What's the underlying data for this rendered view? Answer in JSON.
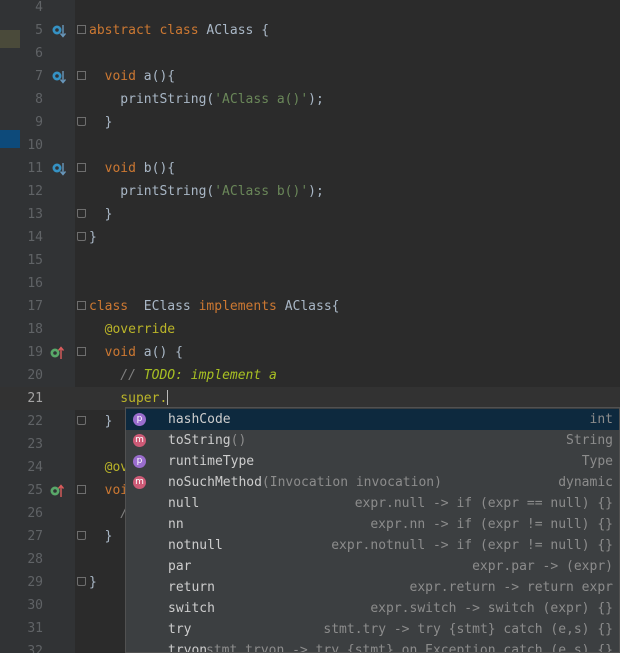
{
  "editor": {
    "rows": [
      {
        "n": "4",
        "tokens": []
      },
      {
        "n": "5",
        "tokens": [
          {
            "t": "abstract class ",
            "c": "kw"
          },
          {
            "t": "AClass {",
            "c": "cls"
          }
        ],
        "icon": "override",
        "fold": "start"
      },
      {
        "n": "6",
        "tokens": []
      },
      {
        "n": "7",
        "tokens": [
          {
            "t": "  void ",
            "c": "kw"
          },
          {
            "t": "a(){",
            "c": "cls"
          }
        ],
        "icon": "override",
        "fold": "start"
      },
      {
        "n": "8",
        "tokens": [
          {
            "t": "    printString(",
            "c": "cls"
          },
          {
            "t": "'AClass a()'",
            "c": "str"
          },
          {
            "t": ");",
            "c": "cls"
          }
        ]
      },
      {
        "n": "9",
        "tokens": [
          {
            "t": "  }",
            "c": "cls"
          }
        ],
        "fold": "end"
      },
      {
        "n": "10",
        "tokens": []
      },
      {
        "n": "11",
        "tokens": [
          {
            "t": "  void ",
            "c": "kw"
          },
          {
            "t": "b(){",
            "c": "cls"
          }
        ],
        "icon": "override",
        "fold": "start"
      },
      {
        "n": "12",
        "tokens": [
          {
            "t": "    printString(",
            "c": "cls"
          },
          {
            "t": "'AClass b()'",
            "c": "str"
          },
          {
            "t": ");",
            "c": "cls"
          }
        ]
      },
      {
        "n": "13",
        "tokens": [
          {
            "t": "  }",
            "c": "cls"
          }
        ],
        "fold": "end"
      },
      {
        "n": "14",
        "tokens": [
          {
            "t": "}",
            "c": "cls"
          }
        ],
        "fold": "end"
      },
      {
        "n": "15",
        "tokens": []
      },
      {
        "n": "16",
        "tokens": []
      },
      {
        "n": "17",
        "tokens": [
          {
            "t": "class  ",
            "c": "kw"
          },
          {
            "t": "EClass ",
            "c": "cls"
          },
          {
            "t": "implements ",
            "c": "kw"
          },
          {
            "t": "AClass{",
            "c": "cls"
          }
        ],
        "fold": "start"
      },
      {
        "n": "18",
        "tokens": [
          {
            "t": "  @override",
            "c": "ann"
          }
        ]
      },
      {
        "n": "19",
        "tokens": [
          {
            "t": "  void ",
            "c": "kw"
          },
          {
            "t": "a() {",
            "c": "cls"
          }
        ],
        "icon": "implements",
        "fold": "start"
      },
      {
        "n": "20",
        "tokens": [
          {
            "t": "    // ",
            "c": "cmt"
          },
          {
            "t": "TODO: implement a",
            "c": "todo"
          }
        ]
      },
      {
        "n": "21",
        "tokens": [
          {
            "t": "    super.",
            "c": "ann"
          }
        ],
        "current": true,
        "caret": true
      },
      {
        "n": "22",
        "tokens": [
          {
            "t": "  }",
            "c": "cls"
          }
        ],
        "fold": "end"
      },
      {
        "n": "23",
        "tokens": []
      },
      {
        "n": "24",
        "tokens": [
          {
            "t": "  @ov",
            "c": "ann"
          }
        ]
      },
      {
        "n": "25",
        "tokens": [
          {
            "t": "  voi",
            "c": "kw"
          }
        ],
        "icon": "implements",
        "fold": "start"
      },
      {
        "n": "26",
        "tokens": [
          {
            "t": "    /",
            "c": "cmt"
          }
        ]
      },
      {
        "n": "27",
        "tokens": [
          {
            "t": "  }",
            "c": "cls"
          }
        ],
        "fold": "end"
      },
      {
        "n": "28",
        "tokens": []
      },
      {
        "n": "29",
        "tokens": [
          {
            "t": "}",
            "c": "cls"
          }
        ],
        "fold": "end"
      },
      {
        "n": "30",
        "tokens": []
      },
      {
        "n": "31",
        "tokens": []
      },
      {
        "n": "32",
        "tokens": []
      }
    ]
  },
  "completion": {
    "items": [
      {
        "icon": "p",
        "name": "hashCode",
        "sig": "",
        "type": "int",
        "selected": true
      },
      {
        "icon": "m",
        "name": "toString",
        "sig": "()",
        "type": "String"
      },
      {
        "icon": "p",
        "name": "runtimeType",
        "sig": "",
        "type": "Type"
      },
      {
        "icon": "m",
        "name": "noSuchMethod",
        "sig": "(Invocation invocation)",
        "type": "dynamic"
      },
      {
        "name": "null",
        "sig": "",
        "type": "expr.null -> if (expr == null) {}"
      },
      {
        "name": "nn",
        "sig": "",
        "type": "expr.nn -> if (expr != null) {}"
      },
      {
        "name": "notnull",
        "sig": "",
        "type": "expr.notnull -> if (expr != null) {}"
      },
      {
        "name": "par",
        "sig": "",
        "type": "expr.par -> (expr)"
      },
      {
        "name": "return",
        "sig": "",
        "type": "expr.return -> return expr"
      },
      {
        "name": "switch",
        "sig": "",
        "type": "expr.switch -> switch (expr) {}"
      },
      {
        "name": "try",
        "sig": "",
        "type": "stmt.try -> try {stmt} catch (e,s) {}"
      },
      {
        "name": "tryon",
        "sig": "",
        "type": "stmt.tryon -> try {stmt} on Exception catch (e,s) {}"
      }
    ]
  },
  "colors": {
    "background": "#2b2b2b",
    "gutter": "#313335",
    "keyword": "#cc7832",
    "string": "#6a8759",
    "annotation": "#bbb529",
    "popup": "#3c3f41",
    "selection": "#0d293e"
  }
}
